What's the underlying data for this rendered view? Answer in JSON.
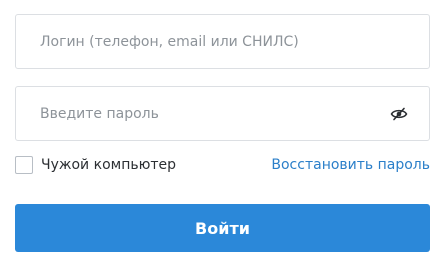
{
  "login": {
    "value": "",
    "placeholder": "Логин (телефон, email или СНИЛС)"
  },
  "password": {
    "value": "",
    "placeholder": "Введите пароль",
    "toggle_icon": "eye-hidden-icon"
  },
  "remember": {
    "label": "Чужой компьютер",
    "checked": false
  },
  "restore_link": "Восстановить пароль",
  "submit_label": "Войти",
  "colors": {
    "accent": "#2b88d9",
    "link": "#2b7fc9",
    "border": "#dcdfe3",
    "placeholder": "#8d9399",
    "text": "#2c2f33"
  }
}
